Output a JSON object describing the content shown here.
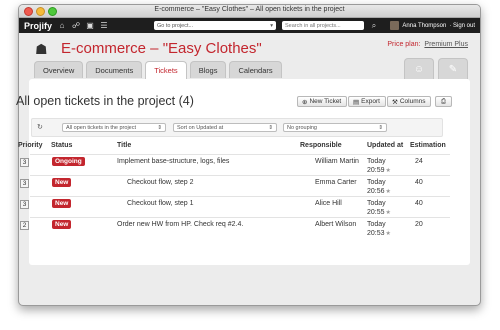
{
  "window": {
    "title": "E-commerce – \"Easy Clothes\" – All open tickets in the project"
  },
  "topnav": {
    "logo": "Projify",
    "project_select": "Go to project...",
    "search_placeholder": "Search in all projects...",
    "user_name": "Anna Thompson",
    "signout": "· Sign out"
  },
  "header": {
    "project_title": "E-commerce – \"Easy Clothes\"",
    "price_label": "Price plan:",
    "price_plan": "Premium Plus",
    "tabs": [
      "Overview",
      "Documents",
      "Tickets",
      "Blogs",
      "Calendars"
    ],
    "active_tab": "Tickets"
  },
  "page": {
    "title": "All open tickets in the project (4)",
    "buttons": {
      "new_ticket": "New Ticket",
      "export": "Export",
      "columns": "Columns"
    }
  },
  "filters": {
    "scope": "All open tickets in the project",
    "sort": "Sort on Updated at",
    "grouping": "No grouping"
  },
  "table": {
    "headers": [
      "Priority",
      "Status",
      "Title",
      "Responsible",
      "Updated at",
      "Estimation"
    ],
    "rows": [
      {
        "priority": "3",
        "status": "Ongoing",
        "status_color": "#c3262e",
        "title": "Implement base-structure, logs, files",
        "responsible": "William Martin",
        "updated_day": "Today",
        "updated_time": "20:59",
        "estimation": "24"
      },
      {
        "priority": "3",
        "status": "New",
        "status_color": "#c3262e",
        "title": "Checkout flow, step 2",
        "responsible": "Emma Carter",
        "updated_day": "Today",
        "updated_time": "20:56",
        "estimation": "40"
      },
      {
        "priority": "3",
        "status": "New",
        "status_color": "#c3262e",
        "title": "Checkout flow, step 1",
        "responsible": "Alice Hill",
        "updated_day": "Today",
        "updated_time": "20:55",
        "estimation": "40"
      },
      {
        "priority": "2",
        "status": "New",
        "status_color": "#c3262e",
        "title": "Order new HW from HP. Check req #2.4.",
        "responsible": "Albert Wilson",
        "updated_day": "Today",
        "updated_time": "20:53",
        "estimation": "20"
      }
    ]
  },
  "colors": {
    "accent": "#c3262e",
    "nav_bg": "#1e1e1e"
  }
}
